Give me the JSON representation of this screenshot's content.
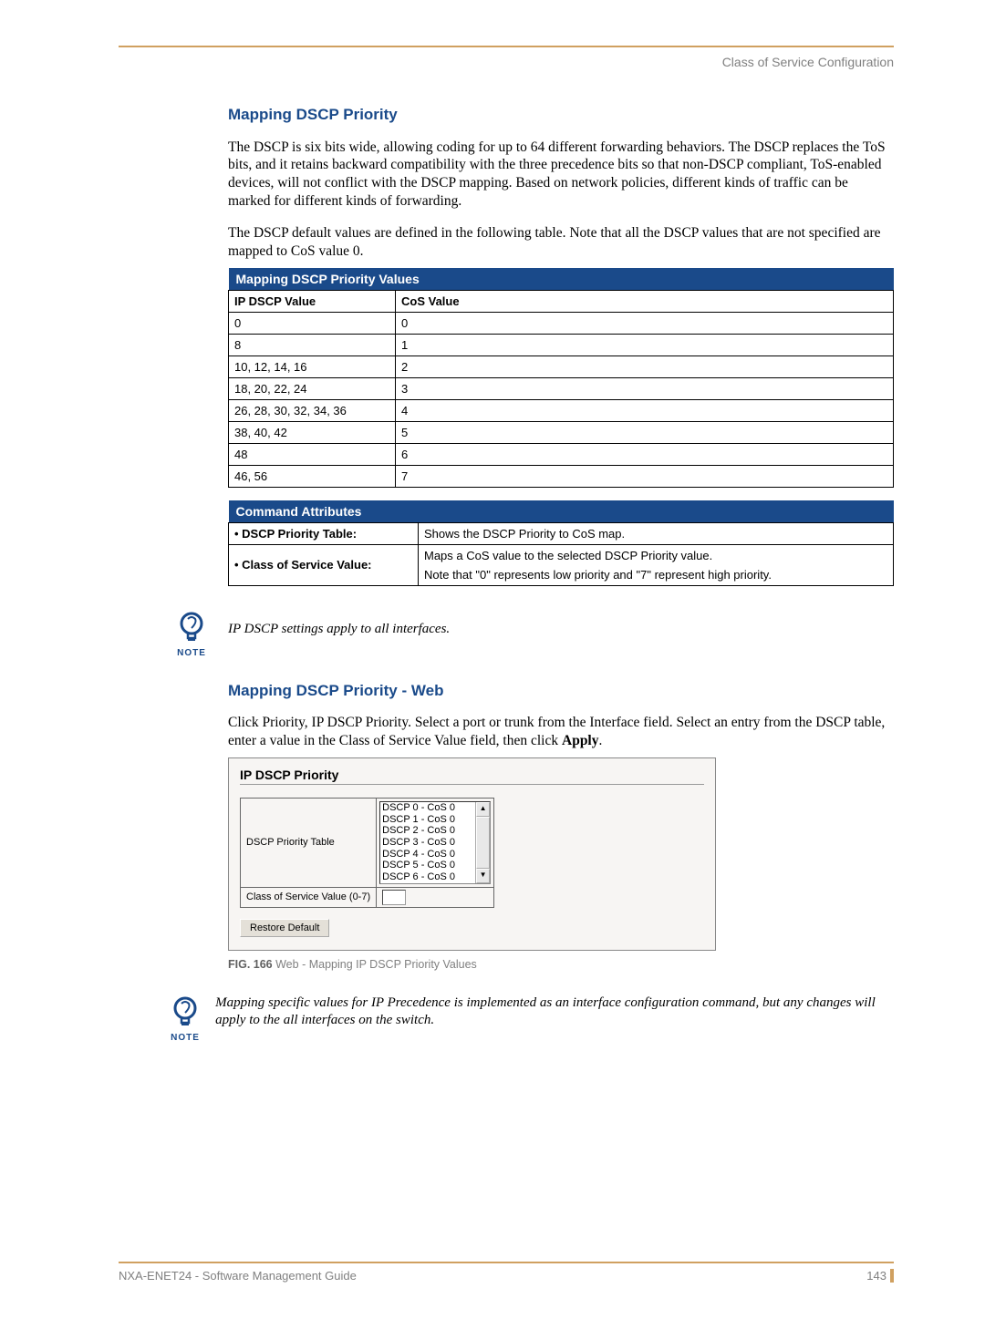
{
  "header": {
    "section": "Class of Service Configuration"
  },
  "sec1": {
    "title": "Mapping DSCP Priority",
    "p1": "The DSCP is six bits wide, allowing coding for up to 64 different forwarding behaviors. The DSCP replaces the ToS bits, and it retains backward compatibility with the three precedence bits so that non-DSCP compliant, ToS-enabled devices, will not conflict with the DSCP mapping. Based on network policies, different kinds of traffic can be marked for different kinds of forwarding.",
    "p2": "The DSCP default values are defined in the following table. Note that all the DSCP values that are not specified are mapped to CoS value 0."
  },
  "table1": {
    "title": "Mapping DSCP Priority Values",
    "col1": "IP DSCP Value",
    "col2": "CoS Value",
    "rows": [
      {
        "a": "0",
        "b": "0"
      },
      {
        "a": "8",
        "b": "1"
      },
      {
        "a": "10, 12, 14, 16",
        "b": "2"
      },
      {
        "a": "18, 20, 22, 24",
        "b": "3"
      },
      {
        "a": "26, 28, 30, 32, 34, 36",
        "b": "4"
      },
      {
        "a": "38, 40, 42",
        "b": "5"
      },
      {
        "a": "48",
        "b": "6"
      },
      {
        "a": "46, 56",
        "b": "7"
      }
    ]
  },
  "table2": {
    "title": "Command Attributes",
    "rows": [
      {
        "label": "• DSCP Priority Table:",
        "desc": "Shows the DSCP Priority to CoS map."
      },
      {
        "label": "• Class of Service Value:",
        "desc": "Maps a CoS value to the selected DSCP Priority value.",
        "desc2": "Note that \"0\" represents low priority and \"7\" represent high priority."
      }
    ]
  },
  "note1": {
    "label": "NOTE",
    "text": "IP DSCP settings apply to all interfaces."
  },
  "sec2": {
    "title": "Mapping DSCP Priority - Web",
    "p1a": "Click Priority, IP DSCP Priority. Select a port or trunk from the Interface field. Select an entry from the DSCP table, enter a value in the Class of Service Value field, then click ",
    "p1b": "Apply",
    "p1c": "."
  },
  "screenshot": {
    "title": "IP DSCP Priority",
    "row1_label": "DSCP Priority Table",
    "list": [
      "DSCP 0 - CoS 0",
      "DSCP 1 - CoS 0",
      "DSCP 2 - CoS 0",
      "DSCP 3 - CoS 0",
      "DSCP 4 - CoS 0",
      "DSCP 5 - CoS 0",
      "DSCP 6 - CoS 0"
    ],
    "row2_label": "Class of Service Value (0-7)",
    "button": "Restore Default"
  },
  "figcap": {
    "fig": "FIG. 166",
    "text": "  Web - Mapping IP DSCP Priority Values"
  },
  "note2": {
    "label": "NOTE",
    "text": "Mapping specific values for IP Precedence is implemented as an interface configuration command, but any changes will apply to the all interfaces on the switch."
  },
  "footer": {
    "left": "NXA-ENET24 - Software Management Guide",
    "page": "143"
  }
}
